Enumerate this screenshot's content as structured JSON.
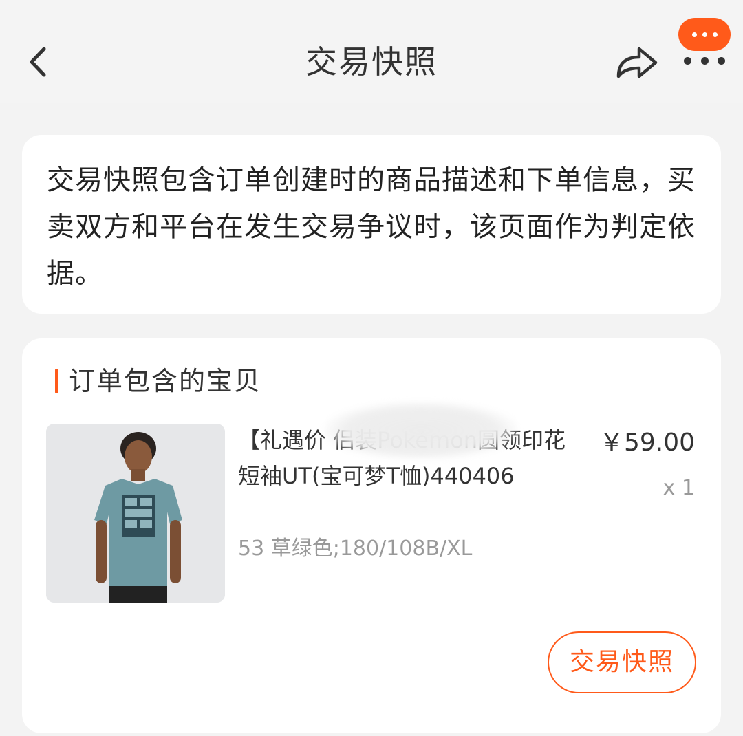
{
  "header": {
    "title": "交易快照",
    "back_icon": "chevron-left-icon",
    "share_icon": "share-icon",
    "more_icon": "more-icon"
  },
  "notice": {
    "text": "交易快照包含订单创建时的商品描述和下单信息，买卖双方和平台在发生交易争议时，该页面作为判定依据。"
  },
  "order_items": {
    "section_title": "订单包含的宝贝",
    "items": [
      {
        "title": "【礼遇价                     侣装Pokémon圆领印花短袖UT(宝可梦T恤)440406",
        "sku": "53 草绿色;180/108B/XL",
        "price": "￥59.00",
        "quantity": "x 1",
        "snapshot_button": "交易快照"
      }
    ]
  },
  "colors": {
    "accent": "#ff5a1a",
    "background": "#f3f3f3",
    "card": "#ffffff",
    "muted_text": "#999999"
  }
}
